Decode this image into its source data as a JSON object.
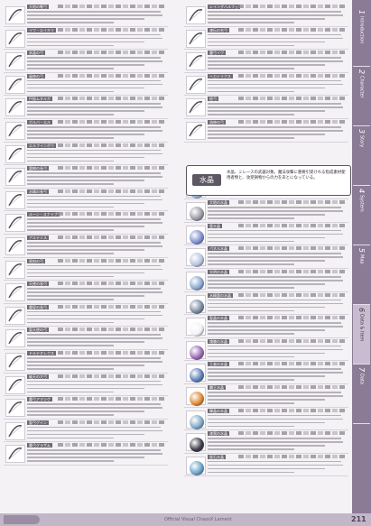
{
  "left_items": [
    {
      "name": "大地の戦弓"
    },
    {
      "name": "イワ・エイキリ"
    },
    {
      "name": "氷晶の弓"
    },
    {
      "name": "風神の弓"
    },
    {
      "name": "円弧ムタルガ"
    },
    {
      "name": "ガルバ・エル"
    },
    {
      "name": "エルフインボウ"
    },
    {
      "name": "霊樹の長弓"
    },
    {
      "name": "水精の長弓"
    },
    {
      "name": "ルーン・スナイプ"
    },
    {
      "name": "アルテミス"
    },
    {
      "name": "冥府の弓"
    },
    {
      "name": "天使の長弓"
    },
    {
      "name": "魔導の長弓"
    },
    {
      "name": "聖天使の弓"
    },
    {
      "name": "ドルテオレクス"
    },
    {
      "name": "破天の大弓"
    },
    {
      "name": "魔弓アマツゲ"
    },
    {
      "name": "聖弓ゲイン"
    },
    {
      "name": "魔弓グラザム"
    }
  ],
  "mid_items": [
    {
      "name": "レイングハルフェ"
    },
    {
      "name": "漆伝の名弓"
    },
    {
      "name": "魔弓イヴ"
    },
    {
      "name": "ヘカトリクス"
    },
    {
      "name": "極弓"
    },
    {
      "name": "流神の弓"
    },
    {
      "name": "水晶"
    },
    {
      "name": "大地の水晶"
    },
    {
      "name": "霊水晶"
    },
    {
      "name": "パネル水晶"
    },
    {
      "name": "光明の水晶"
    },
    {
      "name": "水精霊の水晶"
    },
    {
      "name": "聖晶の水晶"
    },
    {
      "name": "魂魄の水晶"
    },
    {
      "name": "王者の水晶"
    },
    {
      "name": "覇王水晶"
    },
    {
      "name": "輝晶の水晶"
    },
    {
      "name": "漆黒の水晶"
    },
    {
      "name": "星石水晶"
    }
  ],
  "note": {
    "title": "水晶",
    "text": "水晶、ミレースの武器対象。魔法攻撃に重要引受けれる指成素材使用者物と、攻受損物からの力をあとになっている。"
  },
  "tabs": [
    {
      "num": "1",
      "label": "Introduction"
    },
    {
      "num": "2",
      "label": "Character"
    },
    {
      "num": "3",
      "label": "Story"
    },
    {
      "num": "4",
      "label": "System"
    },
    {
      "num": "5",
      "label": "Map"
    },
    {
      "num": "6",
      "label": "Data & Item"
    },
    {
      "num": "7",
      "label": "Data"
    }
  ],
  "footer": {
    "title": "Official Visual ChaosX Lament",
    "page": "211"
  },
  "colors": {
    "sidebar": "#8b7b95",
    "active_tab": "#c9bcd1"
  }
}
